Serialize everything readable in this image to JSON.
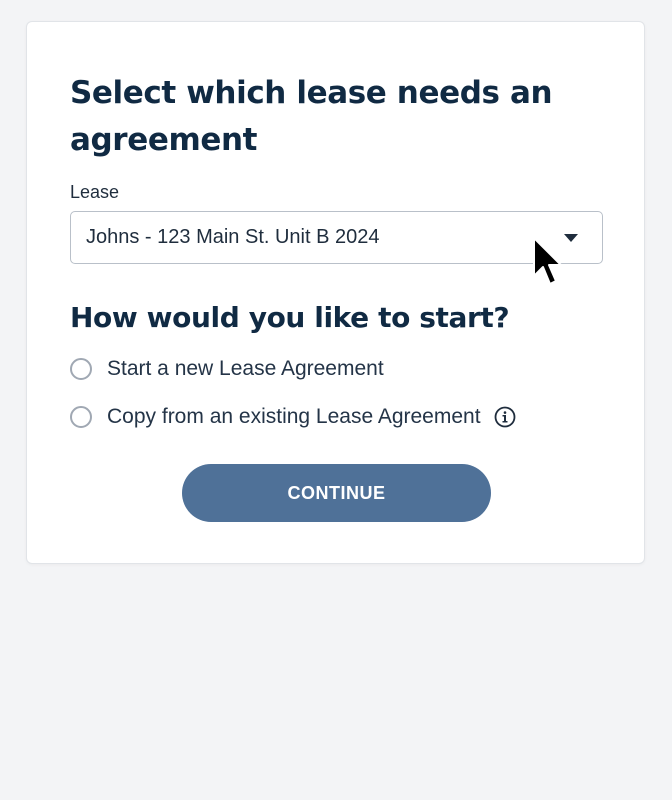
{
  "page": {
    "title": "Select which lease needs an agreement"
  },
  "lease_field": {
    "label": "Lease",
    "selected_value": "Johns - 123 Main St. Unit B 2024",
    "caret_icon": "chevron-down-icon"
  },
  "start_section": {
    "heading": "How would you like to start?",
    "options": [
      {
        "label": "Start a new Lease Agreement",
        "selected": false
      },
      {
        "label": "Copy from an existing Lease Agreement",
        "selected": false,
        "icon": "info-icon"
      }
    ]
  },
  "actions": {
    "continue_label": "CONTINUE"
  },
  "colors": {
    "heading": "#102a43",
    "button": "#4f7198",
    "background": "#f3f4f6"
  }
}
